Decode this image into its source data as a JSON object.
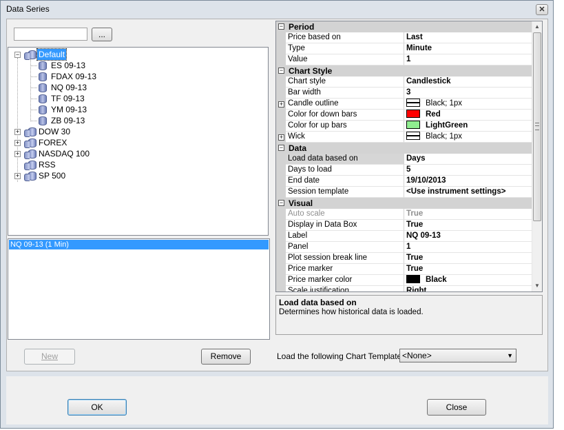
{
  "window": {
    "title": "Data Series",
    "close_glyph": "✕"
  },
  "search": {
    "value": "",
    "browse_label": "..."
  },
  "tree": {
    "items": [
      {
        "label": "Default",
        "expander": "−",
        "kind": "folder"
      },
      {
        "label": "ES 09-13",
        "kind": "instrument"
      },
      {
        "label": "FDAX 09-13",
        "kind": "instrument"
      },
      {
        "label": "NQ 09-13",
        "kind": "instrument"
      },
      {
        "label": "TF 09-13",
        "kind": "instrument"
      },
      {
        "label": "YM 09-13",
        "kind": "instrument"
      },
      {
        "label": "ZB 09-13",
        "kind": "instrument"
      },
      {
        "label": "DOW 30",
        "expander": "+",
        "kind": "folder"
      },
      {
        "label": "FOREX",
        "expander": "+",
        "kind": "folder"
      },
      {
        "label": "NASDAQ 100",
        "expander": "+",
        "kind": "folder"
      },
      {
        "label": "RSS",
        "kind": "folder"
      },
      {
        "label": "SP 500",
        "expander": "+",
        "kind": "folder"
      }
    ]
  },
  "series_list": {
    "items": [
      "NQ 09-13 (1 Min)"
    ]
  },
  "buttons": {
    "new": "New",
    "remove": "Remove",
    "ok": "OK",
    "close": "Close"
  },
  "properties": {
    "period": {
      "title": "Period",
      "toggle": "−",
      "price_based_on": {
        "name": "Price based on",
        "value": "Last"
      },
      "type": {
        "name": "Type",
        "value": "Minute"
      },
      "value": {
        "name": "Value",
        "value": "1"
      }
    },
    "chart_style": {
      "title": "Chart Style",
      "toggle": "−",
      "chart_style": {
        "name": "Chart style",
        "value": "Candlestick"
      },
      "bar_width": {
        "name": "Bar width",
        "value": "3"
      },
      "candle_outline": {
        "name": "Candle outline",
        "value": "Black; 1px",
        "toggle": "+"
      },
      "color_down": {
        "name": "Color for down bars",
        "value": "Red",
        "color": "#ff0000"
      },
      "color_up": {
        "name": "Color for up bars",
        "value": "LightGreen",
        "color": "#90ee90"
      },
      "wick": {
        "name": "Wick",
        "value": "Black; 1px",
        "toggle": "+"
      }
    },
    "data": {
      "title": "Data",
      "toggle": "−",
      "load_based_on": {
        "name": "Load data based on",
        "value": "Days"
      },
      "days_to_load": {
        "name": "Days to load",
        "value": "5"
      },
      "end_date": {
        "name": "End date",
        "value": "19/10/2013"
      },
      "session_template": {
        "name": "Session template",
        "value": "<Use instrument settings>"
      }
    },
    "visual": {
      "title": "Visual",
      "toggle": "−",
      "auto_scale": {
        "name": "Auto scale",
        "value": "True"
      },
      "display_data_box": {
        "name": "Display in Data Box",
        "value": "True"
      },
      "label": {
        "name": "Label",
        "value": "NQ 09-13"
      },
      "panel": {
        "name": "Panel",
        "value": "1"
      },
      "plot_session_break": {
        "name": "Plot session break line",
        "value": "True"
      },
      "price_marker": {
        "name": "Price marker",
        "value": "True"
      },
      "price_marker_color": {
        "name": "Price marker color",
        "value": "Black",
        "color": "#000000"
      },
      "scale_justification": {
        "name": "Scale justification",
        "value": "Right"
      }
    }
  },
  "scroll": {
    "up": "▲",
    "down": "▼"
  },
  "description": {
    "title": "Load data based on",
    "text": "Determines how historical data is loaded."
  },
  "template": {
    "label": "Load the following Chart Template:",
    "value": "<None>",
    "arrow": "▼"
  }
}
